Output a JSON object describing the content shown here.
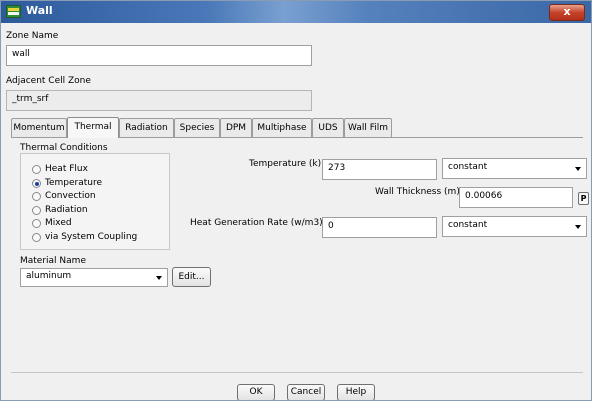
{
  "window": {
    "title": "Wall",
    "close_label": "x"
  },
  "zone": {
    "label": "Zone Name",
    "value": "wall"
  },
  "adjacent": {
    "label": "Adjacent Cell Zone",
    "value": "_trm_srf"
  },
  "tabs": [
    {
      "label": "Momentum"
    },
    {
      "label": "Thermal"
    },
    {
      "label": "Radiation"
    },
    {
      "label": "Species"
    },
    {
      "label": "DPM"
    },
    {
      "label": "Multiphase"
    },
    {
      "label": "UDS"
    },
    {
      "label": "Wall Film"
    }
  ],
  "active_tab": "Thermal",
  "thermal": {
    "group_label": "Thermal Conditions",
    "options": [
      {
        "label": "Heat Flux",
        "checked": false
      },
      {
        "label": "Temperature",
        "checked": true
      },
      {
        "label": "Convection",
        "checked": false
      },
      {
        "label": "Radiation",
        "checked": false
      },
      {
        "label": "Mixed",
        "checked": false
      },
      {
        "label": "via System Coupling",
        "checked": false
      }
    ],
    "temperature_label": "Temperature (k)",
    "temperature_value": "273",
    "temperature_method": "constant",
    "thickness_label": "Wall Thickness (m)",
    "thickness_value": "0.00066",
    "param_button": "P",
    "heatgen_label": "Heat Generation Rate (w/m3)",
    "heatgen_value": "0",
    "heatgen_method": "constant"
  },
  "material": {
    "label": "Material Name",
    "value": "aluminum",
    "edit_label": "Edit..."
  },
  "buttons": {
    "ok": "OK",
    "cancel": "Cancel",
    "help": "Help"
  }
}
